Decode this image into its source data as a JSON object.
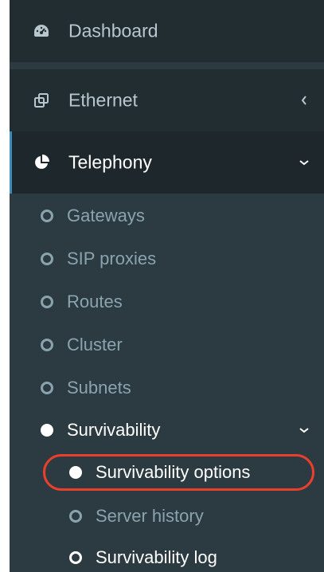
{
  "menu": {
    "dashboard": {
      "label": "Dashboard",
      "icon": "dashboard-icon"
    },
    "ethernet": {
      "label": "Ethernet",
      "icon": "ethernet-icon",
      "chevron": "chevron-left-icon"
    },
    "telephony": {
      "label": "Telephony",
      "icon": "pie-chart-icon",
      "chevron": "chevron-down-icon",
      "active": true
    }
  },
  "telephony_items": [
    {
      "label": "Gateways"
    },
    {
      "label": "SIP proxies"
    },
    {
      "label": "Routes"
    },
    {
      "label": "Cluster"
    },
    {
      "label": "Subnets"
    }
  ],
  "survivability": {
    "label": "Survivability",
    "chevron": "chevron-down-icon",
    "items": [
      {
        "label": "Survivability options",
        "selected": true
      },
      {
        "label": "Server history"
      },
      {
        "label": "Survivability log"
      }
    ]
  },
  "colors": {
    "sidebar_bg": "#2c3b41",
    "item_bg": "#222d32",
    "active_bg": "#1e282c",
    "accent": "#3c8dbc",
    "highlight_ring": "#e8402d"
  }
}
